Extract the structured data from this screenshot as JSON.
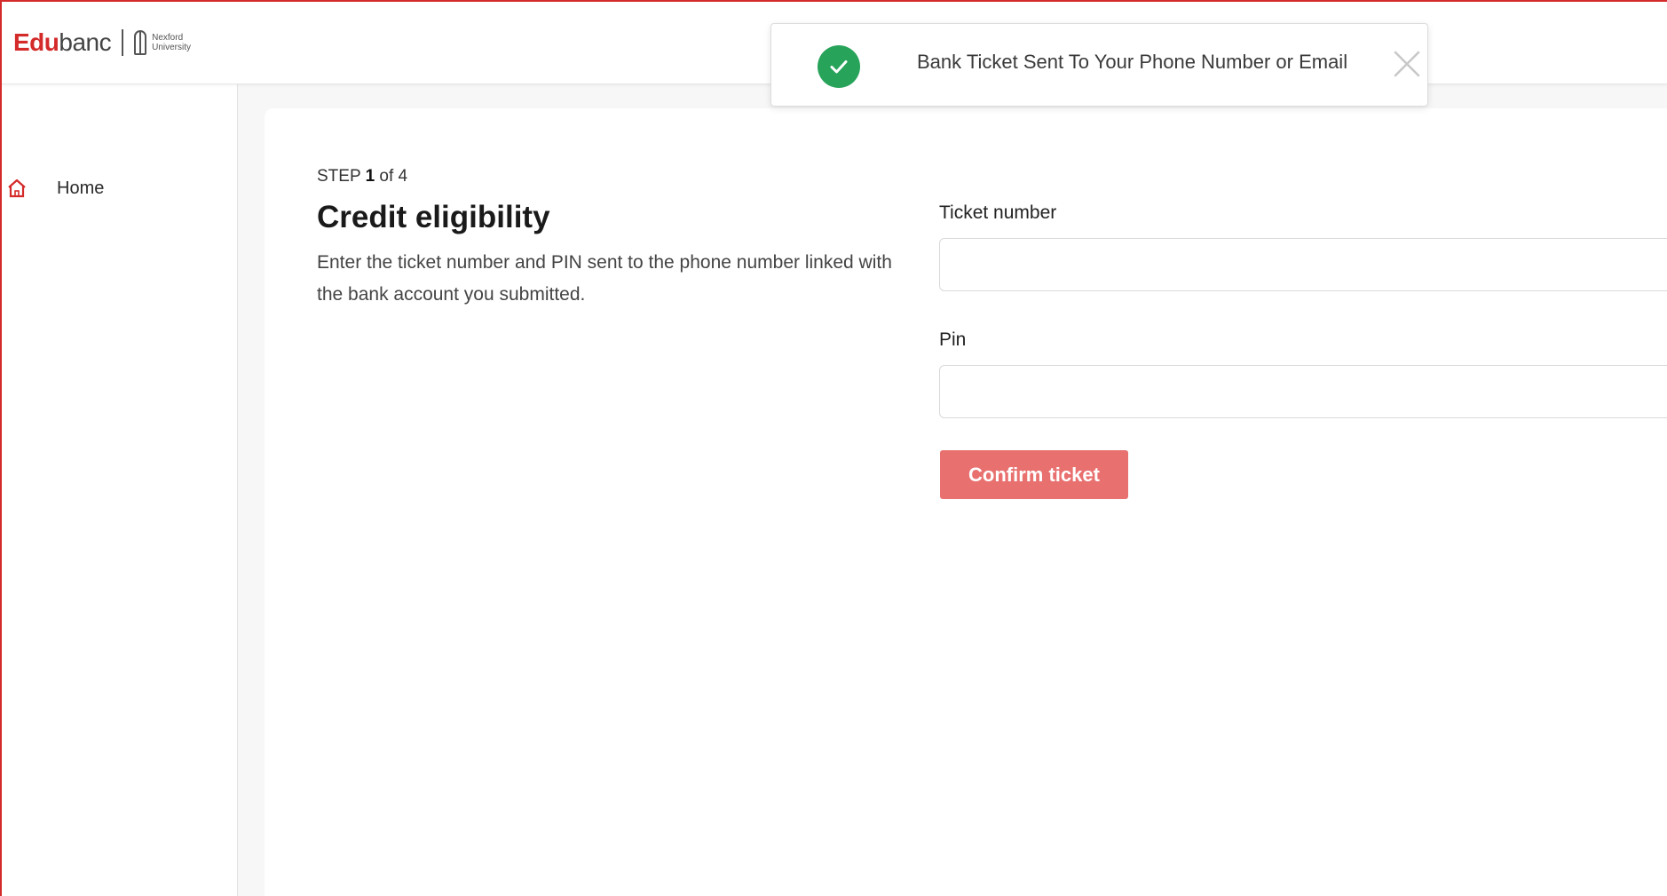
{
  "brand": {
    "name_bold": "Edu",
    "name_regular": "banc",
    "partner_line1": "Nexford",
    "partner_line2": "University",
    "accent_color": "#d42a2a"
  },
  "sidebar": {
    "items": [
      {
        "label": "Home",
        "icon": "home-icon"
      }
    ]
  },
  "main": {
    "step_prefix": "STEP",
    "step_current": "1",
    "step_suffix": "of 4",
    "title": "Credit eligibility",
    "description": "Enter the ticket number and PIN sent to the phone number linked with the bank account you submitted.",
    "fields": {
      "ticket_label": "Ticket number",
      "ticket_value": "",
      "pin_label": "Pin",
      "pin_value": ""
    },
    "confirm_label": "Confirm ticket",
    "button_color": "#e8706f"
  },
  "toast": {
    "message": "Bank Ticket Sent To Your Phone Number or Email",
    "status_icon": "check-circle-icon",
    "status_color": "#27a35a",
    "close_icon": "close-icon"
  }
}
